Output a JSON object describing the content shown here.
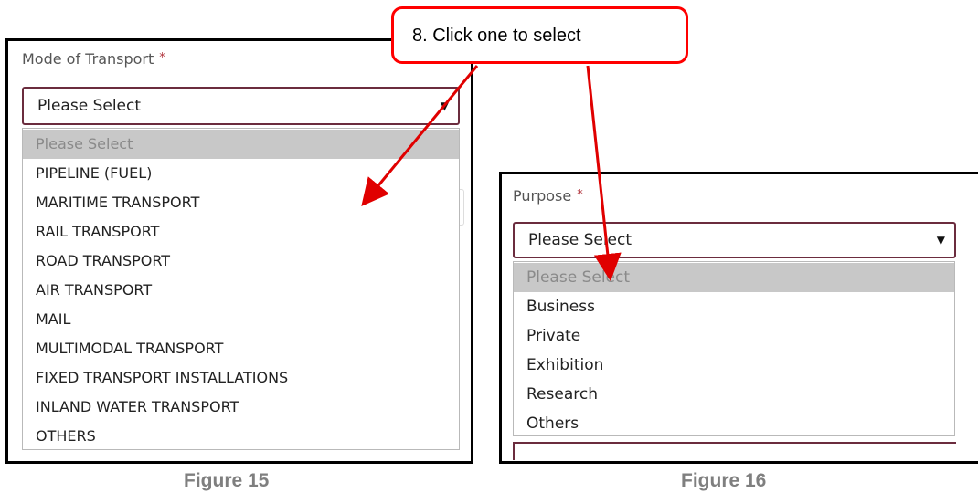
{
  "callout": {
    "text": "8. Click one to select"
  },
  "figure15": {
    "caption": "Figure 15",
    "label": "Mode of Transport",
    "required_mark": "*",
    "selected": "Please Select",
    "options": [
      "Please Select",
      "PIPELINE (FUEL)",
      "MARITIME TRANSPORT",
      "RAIL TRANSPORT",
      "ROAD TRANSPORT",
      "AIR TRANSPORT",
      "MAIL",
      "MULTIMODAL TRANSPORT",
      "FIXED TRANSPORT INSTALLATIONS",
      "INLAND WATER TRANSPORT",
      "OTHERS"
    ]
  },
  "figure16": {
    "caption": "Figure 16",
    "label": "Purpose",
    "required_mark": "*",
    "selected": "Please Select",
    "options": [
      "Please Select",
      "Business",
      "Private",
      "Exhibition",
      "Research",
      "Others"
    ]
  },
  "icons": {
    "dropdown_caret": "▼"
  },
  "colors": {
    "callout_border": "#ff0000",
    "arrow": "#e00000",
    "select_border": "#6b2c3e",
    "highlight_option": "#c8c8c8"
  }
}
